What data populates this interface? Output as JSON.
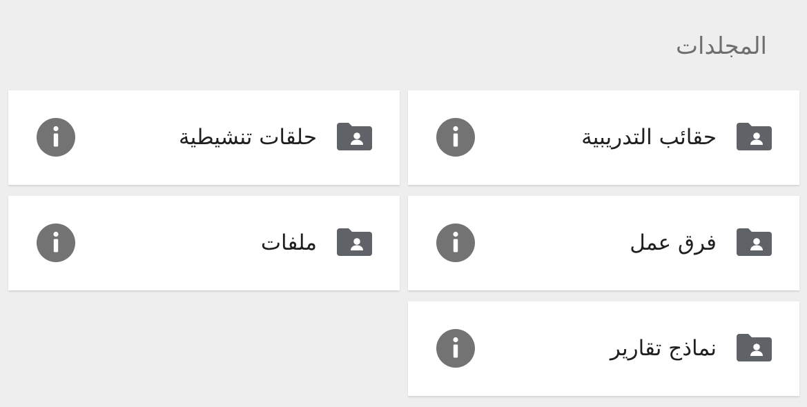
{
  "section": {
    "title": "المجلدات"
  },
  "folders": [
    {
      "label": "حقائب التدريبية",
      "icon": "shared-folder-icon"
    },
    {
      "label": "حلقات تنشيطية",
      "icon": "shared-folder-icon"
    },
    {
      "label": "فرق عمل",
      "icon": "shared-folder-icon"
    },
    {
      "label": "ملفات",
      "icon": "shared-folder-icon"
    },
    {
      "label": "نماذج تقارير",
      "icon": "shared-folder-icon"
    }
  ],
  "info_icon": "info-icon",
  "colors": {
    "background": "#eeeeee",
    "card": "#ffffff",
    "icon": "#5f6368",
    "info": "#737373",
    "text": "#1f1f1f",
    "title": "#6e6e6e"
  }
}
